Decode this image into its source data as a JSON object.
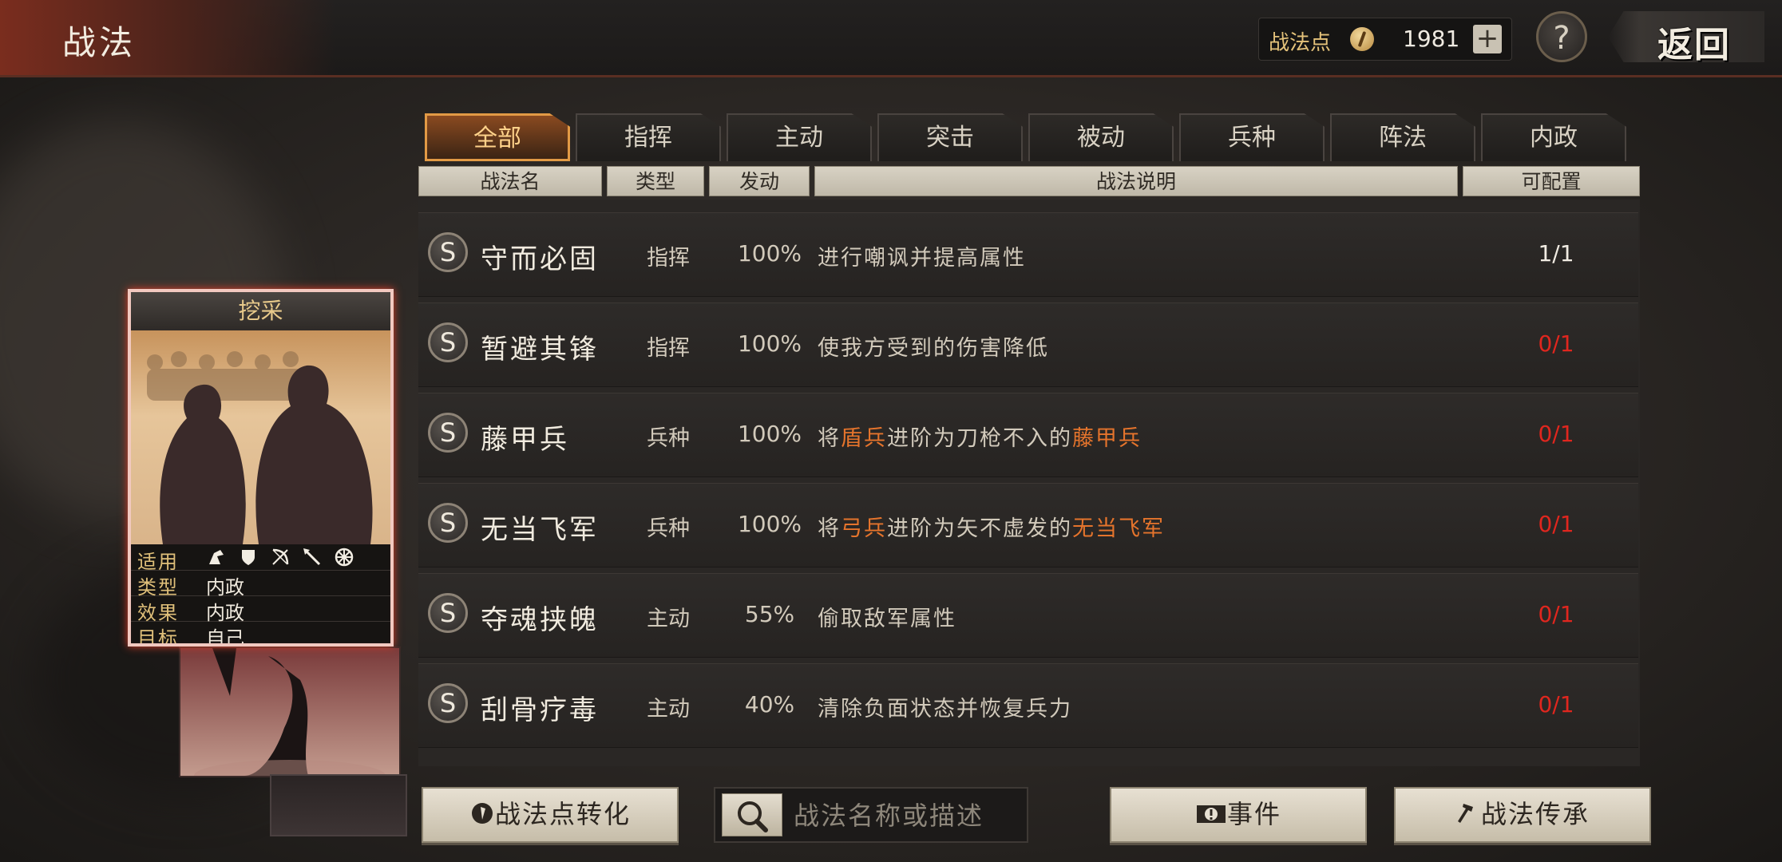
{
  "header": {
    "title": "战法",
    "back_label": "返回",
    "help_label": "?"
  },
  "points": {
    "label": "战法点",
    "value": "1981",
    "plus": "+"
  },
  "tabs": [
    {
      "label": "全部",
      "active": true
    },
    {
      "label": "指挥",
      "active": false
    },
    {
      "label": "主动",
      "active": false
    },
    {
      "label": "突击",
      "active": false
    },
    {
      "label": "被动",
      "active": false
    },
    {
      "label": "兵种",
      "active": false
    },
    {
      "label": "阵法",
      "active": false
    },
    {
      "label": "内政",
      "active": false
    }
  ],
  "columns": {
    "name": "战法名",
    "type": "类型",
    "rate": "发动",
    "desc": "战法说明",
    "avail": "可配置"
  },
  "rows": [
    {
      "badge": "S",
      "name": "守而必固",
      "type": "指挥",
      "rate": "100%",
      "desc": [
        {
          "t": "进行嘲讽并提高属性"
        }
      ],
      "avail": "1/1",
      "avail_color": "#f0ebe2"
    },
    {
      "badge": "S",
      "name": "暂避其锋",
      "type": "指挥",
      "rate": "100%",
      "desc": [
        {
          "t": "使我方受到的伤害降低"
        }
      ],
      "avail": "0/1",
      "avail_color": "#e0261e"
    },
    {
      "badge": "S",
      "name": "藤甲兵",
      "type": "兵种",
      "rate": "100%",
      "desc": [
        {
          "t": "将"
        },
        {
          "t": "盾兵",
          "hl": true
        },
        {
          "t": "进阶为刀枪不入的"
        },
        {
          "t": "藤甲兵",
          "hl": true
        }
      ],
      "avail": "0/1",
      "avail_color": "#e0261e"
    },
    {
      "badge": "S",
      "name": "无当飞军",
      "type": "兵种",
      "rate": "100%",
      "desc": [
        {
          "t": "将"
        },
        {
          "t": "弓兵",
          "hl": true
        },
        {
          "t": "进阶为矢不虚发的"
        },
        {
          "t": "无当飞军",
          "hl": true
        }
      ],
      "avail": "0/1",
      "avail_color": "#e0261e"
    },
    {
      "badge": "S",
      "name": "夺魂挟魄",
      "type": "主动",
      "rate": "55%",
      "desc": [
        {
          "t": "偷取敌军属性"
        }
      ],
      "avail": "0/1",
      "avail_color": "#e0261e"
    },
    {
      "badge": "S",
      "name": "刮骨疗毒",
      "type": "主动",
      "rate": "40%",
      "desc": [
        {
          "t": "清除负面状态并恢复兵力"
        }
      ],
      "avail": "0/1",
      "avail_color": "#e0261e"
    }
  ],
  "card": {
    "title": "挖采",
    "info": [
      {
        "key": "适用",
        "value": ""
      },
      {
        "key": "类型",
        "value": "内政"
      },
      {
        "key": "效果",
        "value": "内政"
      },
      {
        "key": "目标",
        "value": "自己"
      }
    ],
    "unit_icons": [
      "cavalry-icon",
      "shield-icon",
      "bow-icon",
      "spear-icon",
      "chariot-icon"
    ]
  },
  "buttons": {
    "convert": "战法点转化",
    "event": "事件",
    "inherit": "战法传承"
  },
  "search": {
    "placeholder": "战法名称或描述"
  }
}
